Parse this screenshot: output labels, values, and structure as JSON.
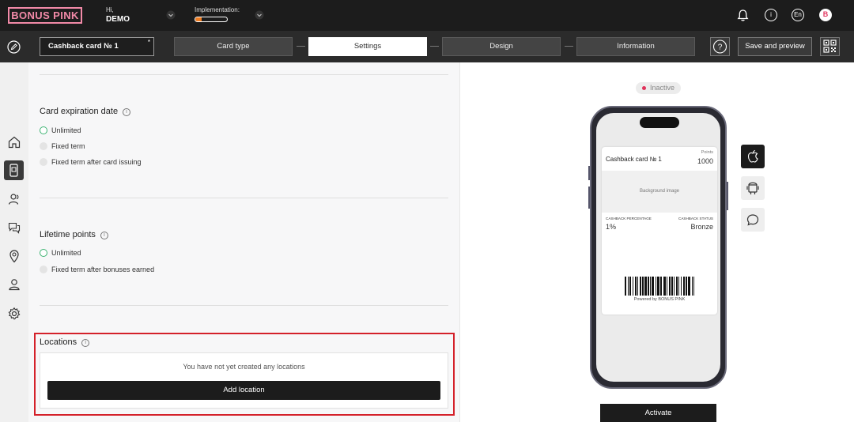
{
  "header": {
    "logo": "BONUS PINK",
    "greeting": "Hi,",
    "user": "DEMO",
    "implementation_label": "Implementation:",
    "implementation_progress": 0.2,
    "lang": "En",
    "avatar_letter": "B"
  },
  "toolbar": {
    "card_name": "Cashback card № 1",
    "required_mark": "*",
    "steps": [
      "Card type",
      "Settings",
      "Design",
      "Information"
    ],
    "active_step": "Settings",
    "help_glyph": "?",
    "save_label": "Save and preview"
  },
  "sidebar": {
    "icons": [
      "home-icon",
      "card-phone-icon",
      "users-icon",
      "chat-icon",
      "location-pin-icon",
      "person-icon",
      "gear-icon"
    ]
  },
  "settings": {
    "expiration": {
      "title": "Card expiration date",
      "options": [
        "Unlimited",
        "Fixed term",
        "Fixed term after card issuing"
      ],
      "selected": "Unlimited"
    },
    "lifetime": {
      "title": "Lifetime points",
      "options": [
        "Unlimited",
        "Fixed term after bonuses earned"
      ],
      "selected": "Unlimited"
    },
    "locations": {
      "title": "Locations",
      "empty_message": "You have not yet created any locations",
      "add_label": "Add location"
    },
    "info_glyph": "i"
  },
  "preview": {
    "status": "Inactive",
    "status_color": "#e0325a",
    "pass": {
      "name": "Cashback card № 1",
      "points_label": "Points",
      "points_value": "1000",
      "background_label": "Background image",
      "field1_label": "CASHBACK PERCENTAGE",
      "field1_value": "1%",
      "field2_label": "CASHBACK STATUS",
      "field2_value": "Bronze",
      "powered": "Powered by BONUS PINK"
    },
    "platforms": [
      "apple-icon",
      "android-icon",
      "message-icon"
    ],
    "activate_label": "Activate"
  }
}
